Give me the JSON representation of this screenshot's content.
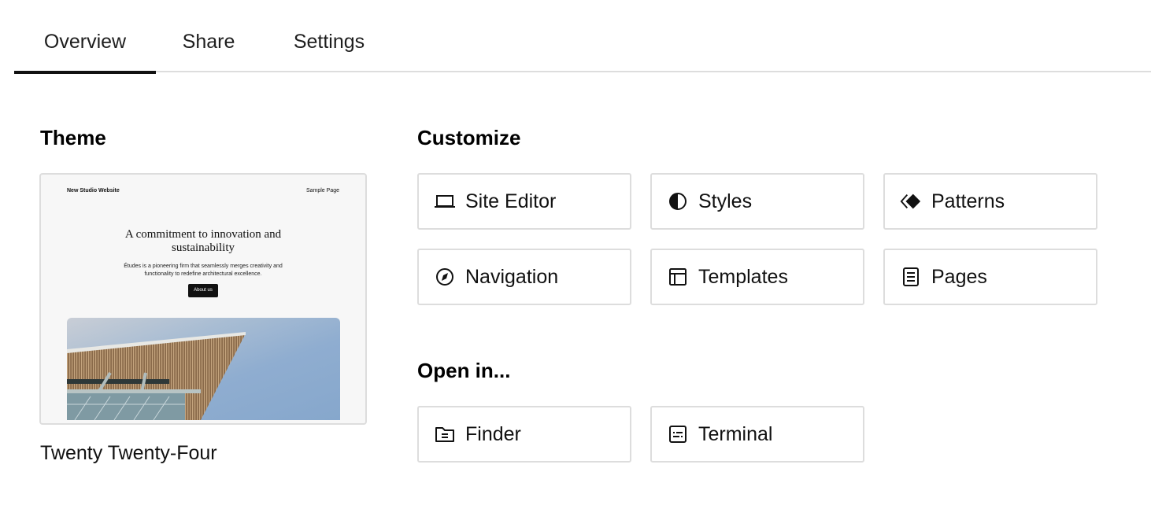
{
  "tabs": [
    {
      "label": "Overview",
      "active": true
    },
    {
      "label": "Share",
      "active": false
    },
    {
      "label": "Settings",
      "active": false
    }
  ],
  "theme": {
    "heading": "Theme",
    "name": "Twenty Twenty-Four",
    "preview": {
      "site_title": "New Studio Website",
      "nav_link": "Sample Page",
      "headline": "A commitment to innovation and sustainability",
      "description": "Études is a pioneering firm that seamlessly merges creativity and functionality to redefine architectural excellence.",
      "button": "About us",
      "image": "building-roof-against-sky"
    }
  },
  "customize": {
    "heading": "Customize",
    "items": [
      {
        "label": "Site Editor",
        "icon": "laptop-icon"
      },
      {
        "label": "Styles",
        "icon": "half-circle-icon"
      },
      {
        "label": "Patterns",
        "icon": "patterns-diamond-icon"
      },
      {
        "label": "Navigation",
        "icon": "compass-icon"
      },
      {
        "label": "Templates",
        "icon": "layout-icon"
      },
      {
        "label": "Pages",
        "icon": "page-icon"
      }
    ]
  },
  "open_in": {
    "heading": "Open in...",
    "items": [
      {
        "label": "Finder",
        "icon": "folder-icon"
      },
      {
        "label": "Terminal",
        "icon": "terminal-icon"
      }
    ]
  },
  "colors": {
    "active_tab_indicator": "#111111",
    "border": "#dddddd"
  }
}
